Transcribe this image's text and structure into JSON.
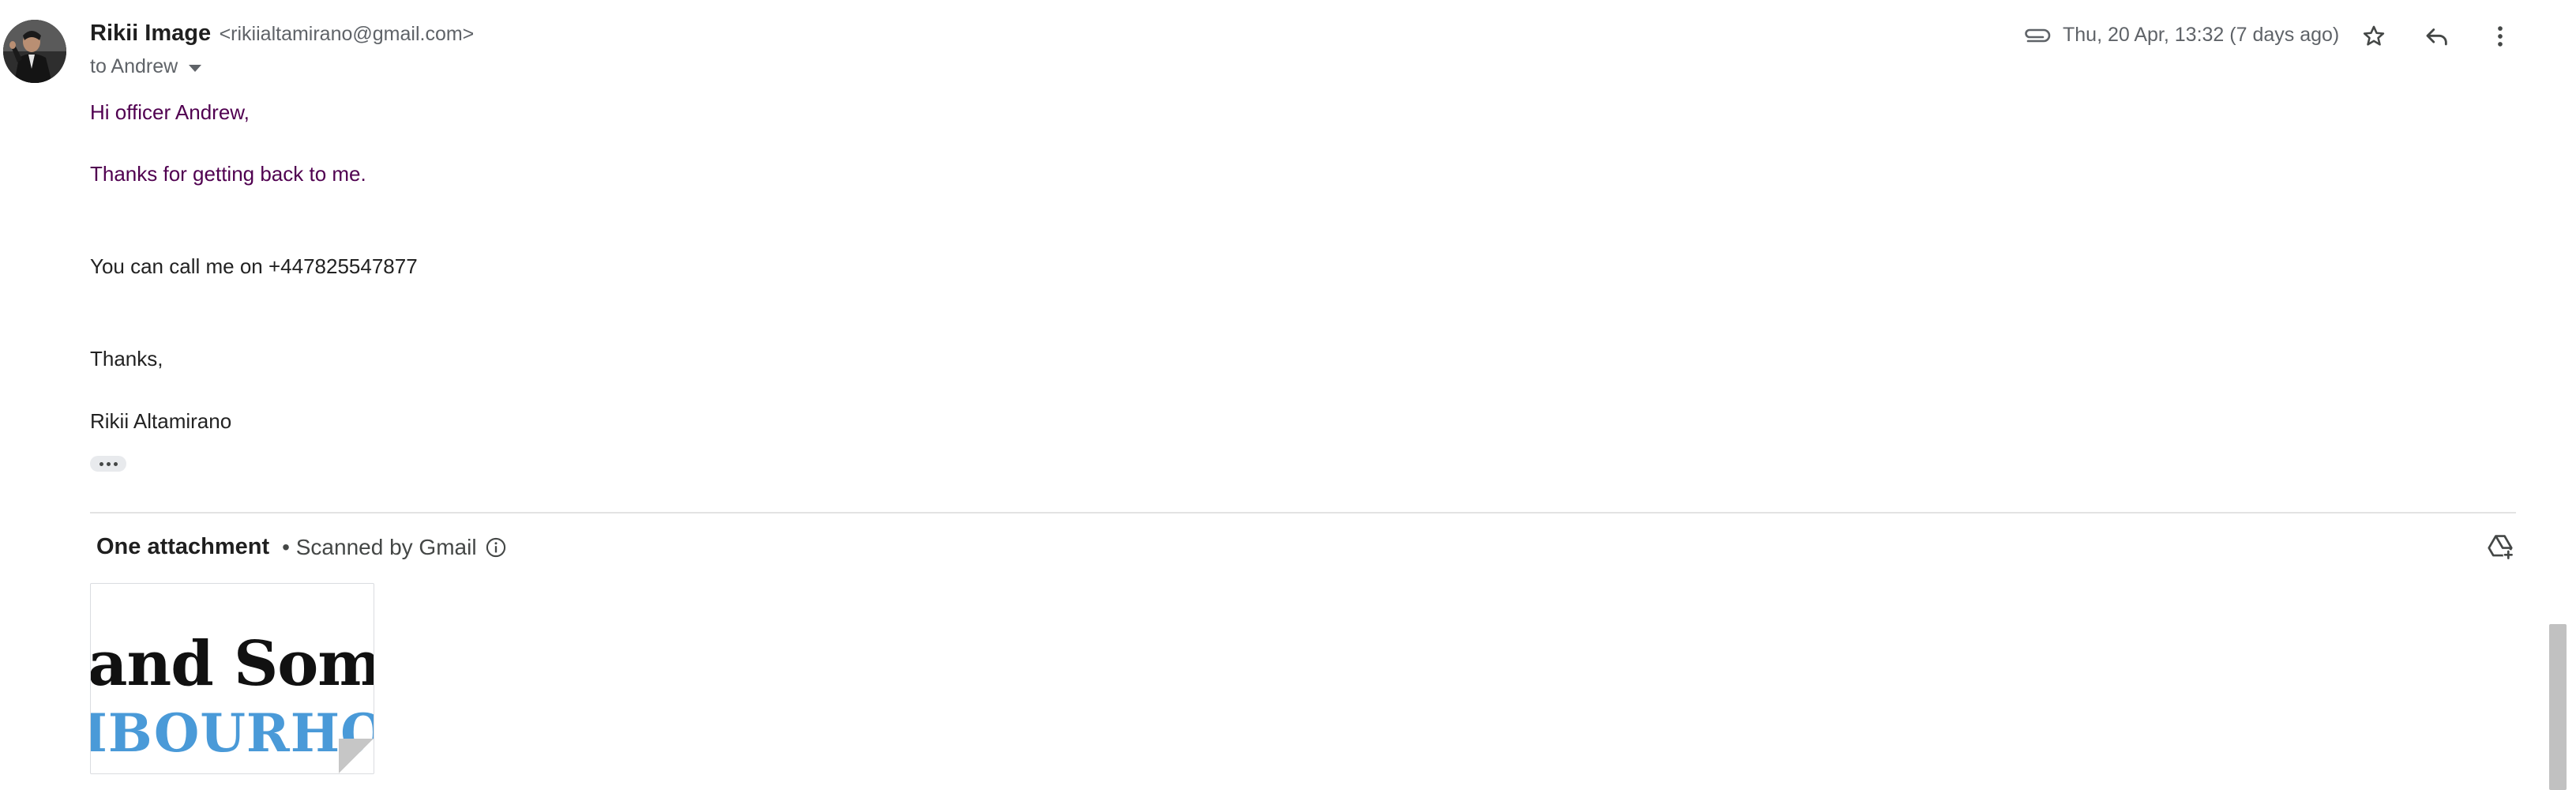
{
  "sender": {
    "name": "Rikii Image",
    "email": "<rikiialtamirano@gmail.com>",
    "recipient_label": "to Andrew"
  },
  "meta": {
    "date": "Thu, 20 Apr, 13:32 (7 days ago)"
  },
  "icons": {
    "attachment": "paperclip-icon",
    "star": "star-icon",
    "reply": "reply-icon",
    "more": "more-vert-icon",
    "info": "info-icon",
    "drive": "add-to-drive-icon",
    "expand": "show-trimmed-content-icon"
  },
  "message": {
    "greeting": "Hi officer Andrew,",
    "thanks_line": "Thanks for getting back to me.",
    "phone_line": "You can call me on +447825547877",
    "signoff": "Thanks,",
    "signature": "Rikii Altamirano"
  },
  "attachments": {
    "title": "One attachment",
    "scanned_label": "• Scanned by Gmail",
    "thumbnail_line1": "and Some",
    "thumbnail_line2": "IBOURHOOD"
  },
  "colors": {
    "quoted_text": "#500050",
    "thumbnail_accent": "#4a9ad8"
  }
}
